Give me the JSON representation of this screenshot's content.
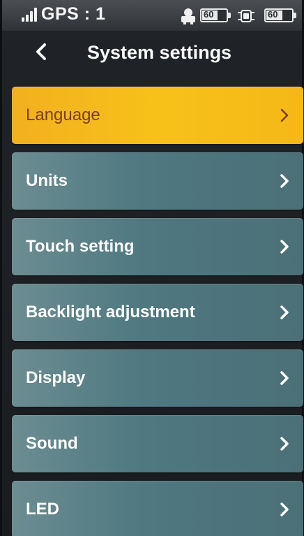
{
  "status_bar": {
    "gps_text": "GPS : 1",
    "signal_level": 4,
    "transmitter_battery": "60",
    "aircraft_battery": "60"
  },
  "header": {
    "title": "System settings",
    "back_icon": "chevron-left-icon"
  },
  "menu": {
    "items": [
      {
        "label": "Language",
        "selected": true,
        "icon": "chevron-right-icon"
      },
      {
        "label": "Units",
        "selected": false,
        "icon": "chevron-right-icon"
      },
      {
        "label": "Touch setting",
        "selected": false,
        "icon": "chevron-right-icon"
      },
      {
        "label": "Backlight adjustment",
        "selected": false,
        "icon": "chevron-right-icon"
      },
      {
        "label": "Display",
        "selected": false,
        "icon": "chevron-right-icon"
      },
      {
        "label": "Sound",
        "selected": false,
        "icon": "chevron-right-icon"
      },
      {
        "label": "LED",
        "selected": false,
        "icon": "chevron-right-icon"
      }
    ]
  },
  "colors": {
    "selected_item": "#f7c11a",
    "selected_text": "#7a3f1a",
    "item_background": "#517a82",
    "screen_background": "#1c1f22"
  }
}
